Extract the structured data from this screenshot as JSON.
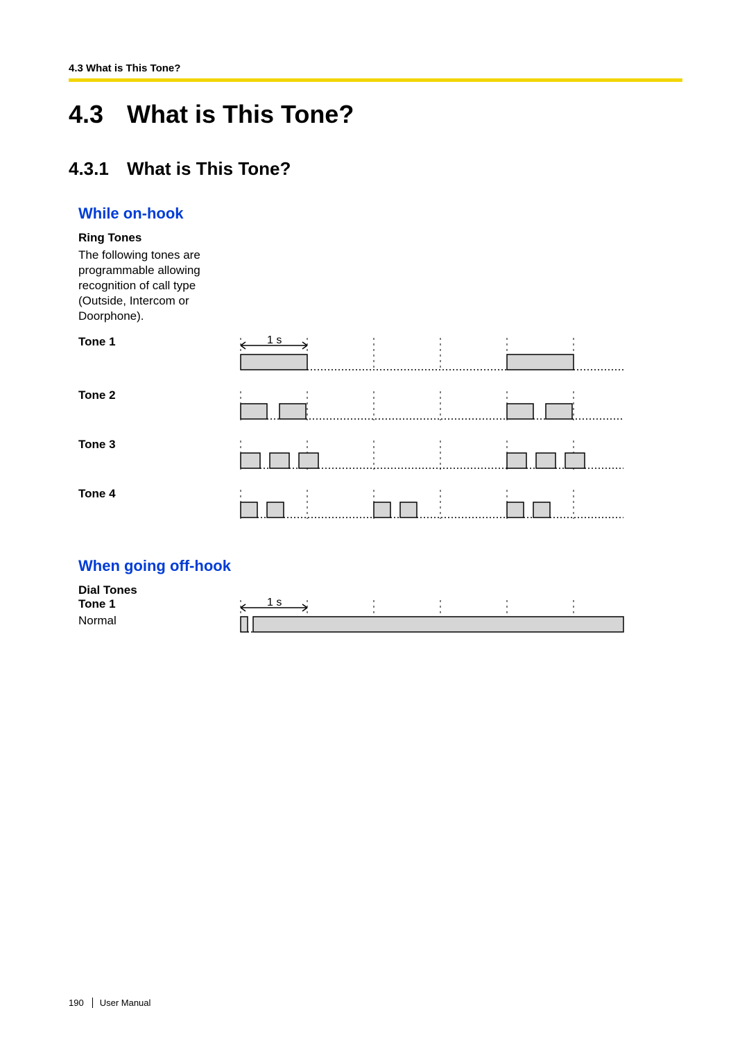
{
  "header": {
    "running": "4.3 What is This Tone?"
  },
  "section": {
    "number": "4.3",
    "title": "What is This Tone?"
  },
  "subsection": {
    "number": "4.3.1",
    "title": "What is This Tone?"
  },
  "onhook": {
    "heading": "While on-hook",
    "ring_tones_label": "Ring Tones",
    "ring_tones_desc": "The following tones are programmable allowing recognition of call type (Outside, Intercom or Doorphone).",
    "tone1_label": "Tone 1",
    "tone2_label": "Tone 2",
    "tone3_label": "Tone 3",
    "tone4_label": "Tone 4",
    "time_label": "1 s"
  },
  "offhook": {
    "heading": "When going off-hook",
    "dial_tones_label": "Dial Tones",
    "tone1_label": "Tone 1",
    "tone1_desc": "Normal",
    "time_label": "1 s"
  },
  "footer": {
    "page": "190",
    "title": "User Manual"
  },
  "chart_data": {
    "type": "timing",
    "time_unit": "seconds",
    "tick_interval": 1,
    "duration_shown": 5,
    "ring_tones": [
      {
        "name": "Tone 1",
        "period": 4,
        "pulses_s": [
          [
            0.0,
            1.0
          ]
        ]
      },
      {
        "name": "Tone 2",
        "period": 4,
        "pulses_s": [
          [
            0.0,
            0.4
          ],
          [
            0.6,
            1.0
          ]
        ]
      },
      {
        "name": "Tone 3",
        "period": 4,
        "pulses_s": [
          [
            0.0,
            0.3
          ],
          [
            0.45,
            0.75
          ],
          [
            0.9,
            1.2
          ]
        ]
      },
      {
        "name": "Tone 4",
        "period": 2,
        "pulses_s": [
          [
            0.0,
            0.25
          ],
          [
            0.4,
            0.65
          ]
        ]
      }
    ],
    "dial_tones": [
      {
        "name": "Tone 1",
        "desc": "Normal",
        "pulses_s": [
          [
            0.0,
            0.1
          ],
          [
            0.2,
            5.2
          ]
        ]
      }
    ]
  }
}
